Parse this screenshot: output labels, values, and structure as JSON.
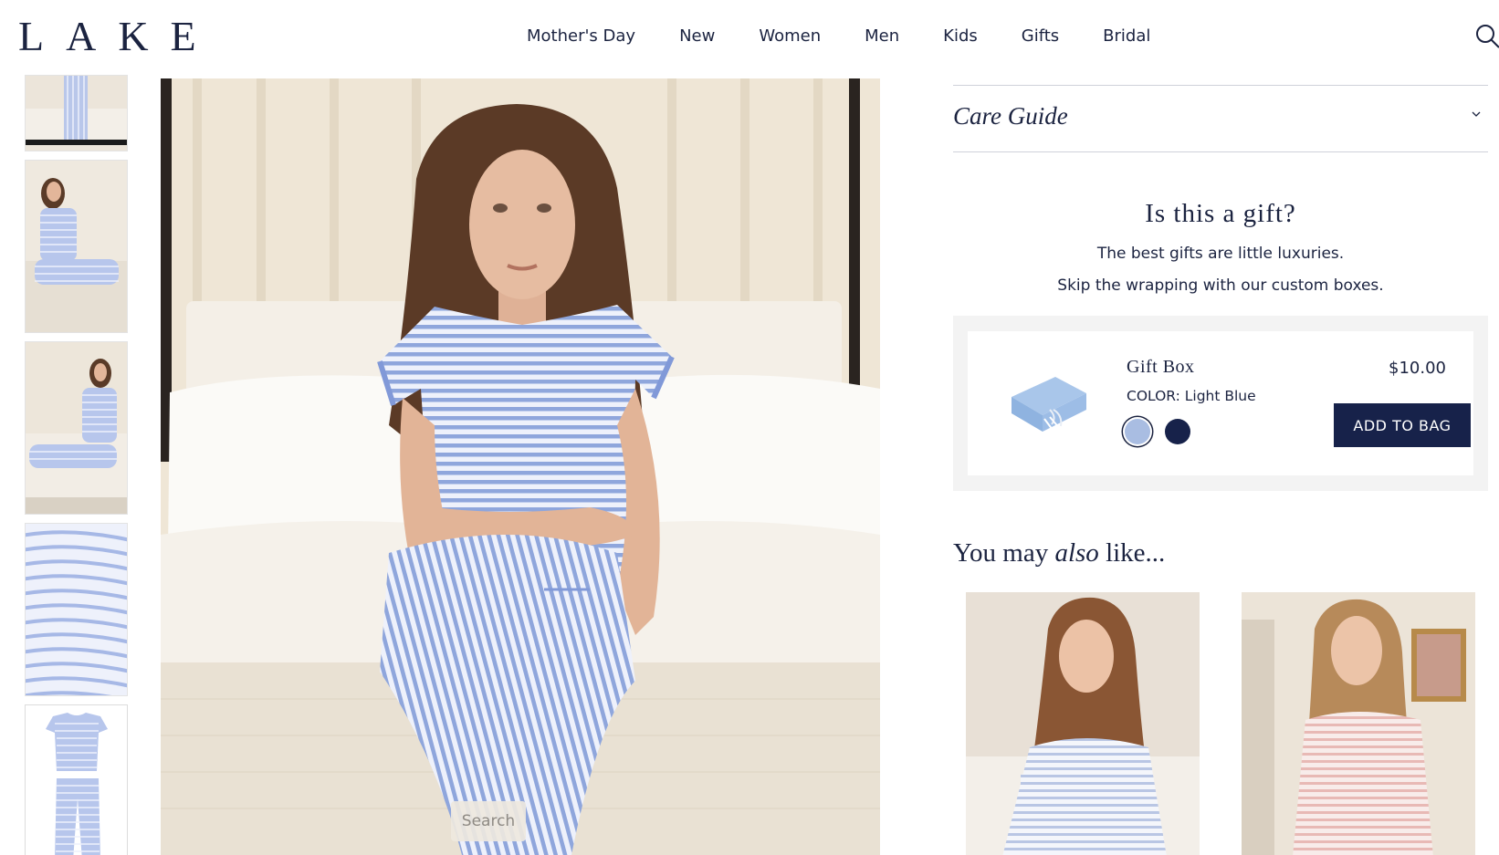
{
  "header": {
    "logo": "LAKE",
    "nav": [
      "Mother's Day",
      "New",
      "Women",
      "Men",
      "Kids",
      "Gifts",
      "Bridal"
    ]
  },
  "care_guide": {
    "title": "Care Guide"
  },
  "gift": {
    "heading": "Is this a gift?",
    "sub1": "The best gifts are little luxuries.",
    "sub2": "Skip the wrapping with our custom boxes.",
    "name": "Gift Box",
    "color_label": "COLOR: Light Blue",
    "price": "$10.00",
    "add_button": "ADD TO BAG",
    "swatches": [
      "#a9bde2",
      "#17224a"
    ]
  },
  "also_like": {
    "prefix": "You may ",
    "emph": "also",
    "suffix": " like..."
  },
  "search_pill": "Search",
  "colors": {
    "navy": "#17224a",
    "text": "#1b2340",
    "stripe": "#8fa6dc"
  }
}
